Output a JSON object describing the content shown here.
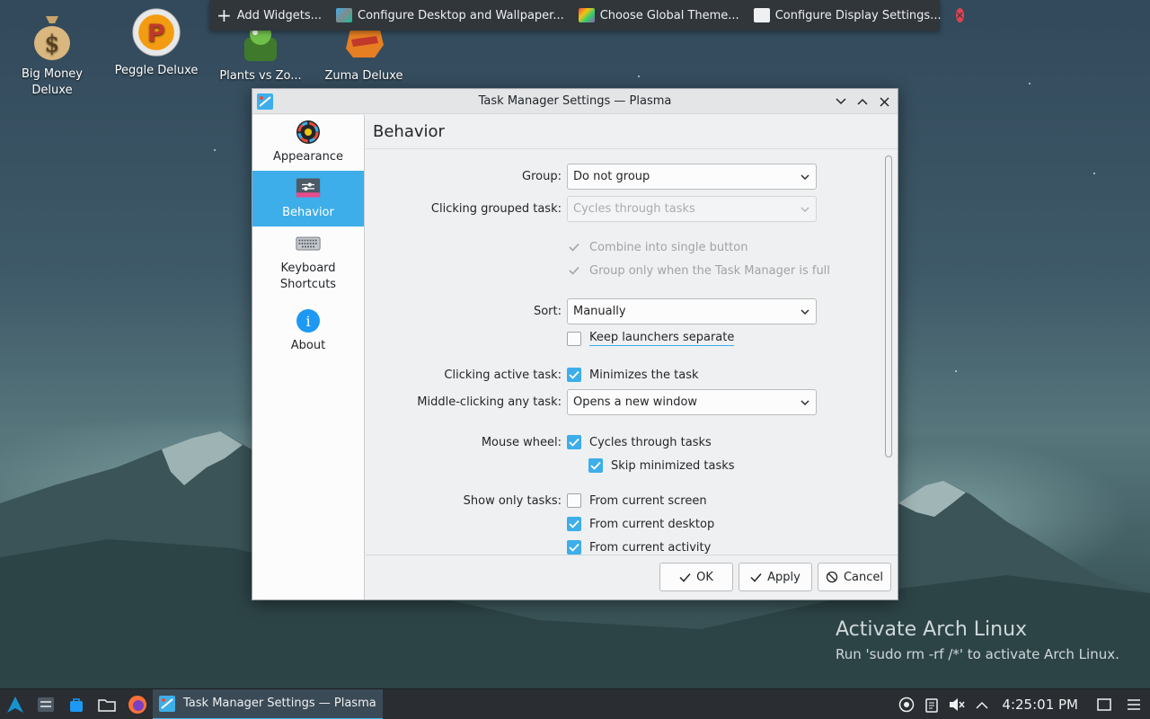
{
  "top_toolbar": {
    "items": [
      {
        "label": "Add Widgets...",
        "icon": "plus-icon"
      },
      {
        "label": "Configure Desktop and Wallpaper...",
        "icon": "wallpaper-icon"
      },
      {
        "label": "Choose Global Theme...",
        "icon": "theme-icon"
      },
      {
        "label": "Configure Display Settings...",
        "icon": "display-icon"
      }
    ],
    "close_icon": "close-icon"
  },
  "desktop_icons": [
    {
      "label": "Big Money Deluxe",
      "icon": "money-bag-icon"
    },
    {
      "label": "Peggle Deluxe",
      "icon": "peggle-icon"
    },
    {
      "label": "Plants vs Zo...",
      "icon": "plants-icon"
    },
    {
      "label": "Zuma Deluxe",
      "icon": "zuma-icon"
    }
  ],
  "dialog": {
    "title": "Task Manager Settings — Plasma",
    "sidebar": [
      {
        "label": "Appearance",
        "icon": "appearance-icon",
        "active": false
      },
      {
        "label": "Behavior",
        "icon": "behavior-icon",
        "active": true
      },
      {
        "label": "Keyboard Shortcuts",
        "icon": "keyboard-icon",
        "active": false
      },
      {
        "label": "About",
        "icon": "info-icon",
        "active": false
      }
    ],
    "page_title": "Behavior",
    "form": {
      "group_label": "Group:",
      "group_value": "Do not group",
      "clicking_grouped_label": "Clicking grouped task:",
      "clicking_grouped_value": "Cycles through tasks",
      "combine_label": "Combine into single button",
      "group_only_label": "Group only when the Task Manager is full",
      "sort_label": "Sort:",
      "sort_value": "Manually",
      "keep_launchers_label": "Keep launchers separate",
      "clicking_active_label": "Clicking active task:",
      "minimizes_label": "Minimizes the task",
      "middle_click_label": "Middle-clicking any task:",
      "middle_click_value": "Opens a new window",
      "mouse_wheel_label": "Mouse wheel:",
      "cycles_label": "Cycles through tasks",
      "skip_minimized_label": "Skip minimized tasks",
      "show_only_label": "Show only tasks:",
      "from_screen_label": "From current screen",
      "from_desktop_label": "From current desktop",
      "from_activity_label": "From current activity"
    },
    "buttons": {
      "ok": "OK",
      "apply": "Apply",
      "cancel": "Cancel"
    }
  },
  "watermark": {
    "title": "Activate Arch Linux",
    "subtitle": "Run 'sudo rm -rf /*' to activate Arch Linux."
  },
  "taskbar": {
    "task_label": "Task Manager Settings — Plasma",
    "clock": "4:25:01 PM"
  },
  "colors": {
    "accent": "#3daee9",
    "panel": "#2a2e32"
  }
}
